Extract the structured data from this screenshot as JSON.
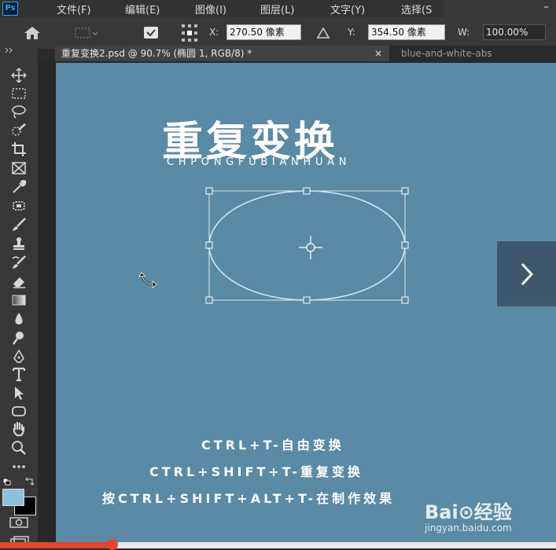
{
  "app": {
    "logo": "Ps"
  },
  "menu": [
    "文件(F)",
    "编辑(E)",
    "图像(I)",
    "图层(L)",
    "文字(Y)",
    "选择(S"
  ],
  "options": {
    "x_label": "X:",
    "x_value": "270.50 像素",
    "y_label": "Y:",
    "y_value": "354.50 像素",
    "w_label": "W:",
    "w_value": "100.00%"
  },
  "tabs": [
    {
      "label": "重复变换2.psd @ 90.7% (椭圆 1, RGB/8) *",
      "close": "×",
      "active": true
    },
    {
      "label": "blue-and-white-abs",
      "active": false
    }
  ],
  "tools": [
    "move-icon",
    "marquee-icon",
    "lasso-icon",
    "quick-select-icon",
    "crop-icon",
    "frame-icon",
    "eyedropper-icon",
    "heal-icon",
    "brush-icon",
    "stamp-icon",
    "history-brush-icon",
    "eraser-icon",
    "gradient-icon",
    "blur-icon",
    "dodge-icon",
    "pen-icon",
    "type-icon",
    "path-select-icon",
    "shape-icon",
    "hand-icon",
    "zoom-icon",
    "more-icon"
  ],
  "canvas": {
    "title": "重复变换",
    "subtitle": "CHPONGFUBIANHUAN",
    "lines": [
      "CTRL+T-自由变换",
      "CTRL+SHIFT+T-重复变换",
      "按CTRL+SHIFT+ALT+T-在制作效果"
    ],
    "background": "#5a8aa5"
  },
  "watermark": {
    "brand": "Bai⊙经验",
    "site": "jingyan.baidu.com"
  },
  "colors": {
    "accent": "#31a8ff",
    "canvas": "#5a8aa5",
    "handle": "#ffffff"
  }
}
